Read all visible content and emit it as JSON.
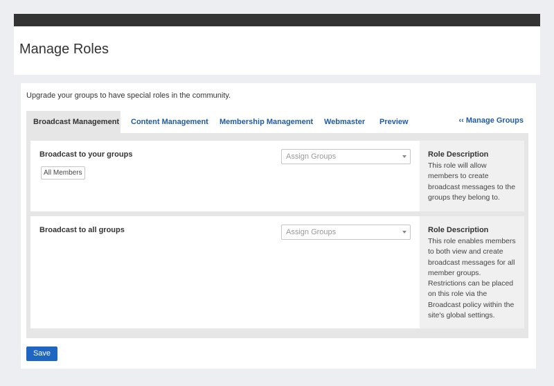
{
  "page": {
    "title": "Manage Roles",
    "intro": "Upgrade your groups to have special roles in the community."
  },
  "tabs": [
    {
      "label": "Broadcast Management",
      "active": true
    },
    {
      "label": "Content Management",
      "active": false
    },
    {
      "label": "Membership Management",
      "active": false
    },
    {
      "label": "Webmaster",
      "active": false
    },
    {
      "label": "Preview",
      "active": false
    }
  ],
  "manage_groups_link": "‹‹ Manage Groups",
  "roles": [
    {
      "title": "Broadcast to your groups",
      "select_placeholder": "Assign Groups",
      "assigned": [
        "All Members"
      ],
      "desc_title": "Role Description",
      "desc_text": "This role will allow members to create broadcast messages to the groups they belong to."
    },
    {
      "title": "Broadcast to all groups",
      "select_placeholder": "Assign Groups",
      "assigned": [],
      "desc_title": "Role Description",
      "desc_text": "This role enables members to both view and create broadcast messages for all member groups. Restrictions can be placed on this role via the Broadcast policy within the site's global settings."
    }
  ],
  "save_label": "Save",
  "colors": {
    "link": "#1f5aa6",
    "button": "#1f66c2",
    "topbar": "#333333",
    "background": "#eceef2"
  }
}
